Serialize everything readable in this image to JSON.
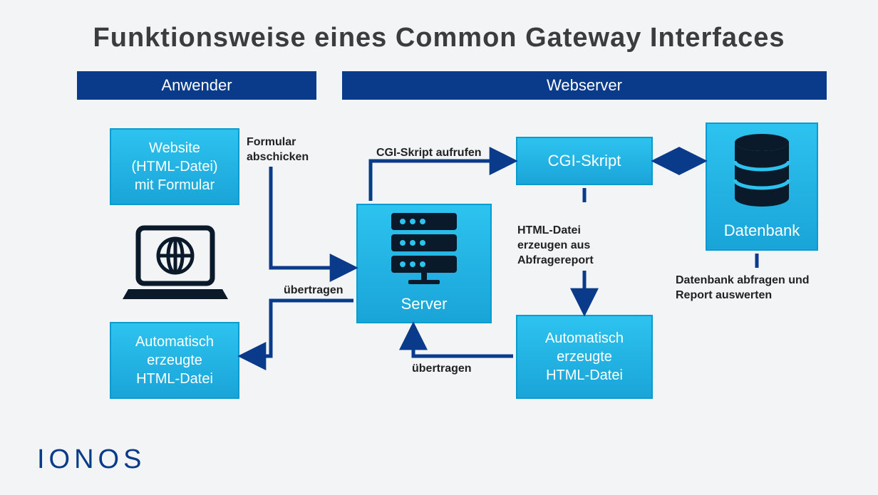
{
  "title": "Funktionsweise eines Common Gateway Interfaces",
  "sections": {
    "anwender": "Anwender",
    "webserver": "Webserver"
  },
  "nodes": {
    "website": "Website\n(HTML-Datei)\nmit Formular",
    "auto1": "Automatisch\nerzeugte\nHTML-Datei",
    "server": "Server",
    "cgi": "CGI-Skript",
    "auto2": "Automatisch\nerzeugte\nHTML-Datei",
    "db": "Datenbank"
  },
  "labels": {
    "formular": "Formular\nabschicken",
    "uebertragen1": "übertragen",
    "cgi_aufrufen": "CGI-Skript aufrufen",
    "html_erzeugen": "HTML-Datei\nerzeugen aus\nAbfragereport",
    "uebertragen2": "übertragen",
    "db_abfragen": "Datenbank abfragen und\nReport auswerten"
  },
  "brand": "IONOS",
  "colors": {
    "header_bg": "#0a3a8a",
    "node_top": "#2dc3ef",
    "node_bottom": "#1aa4d8",
    "arrow": "#0a3a8a",
    "icon_dark": "#0a1a2a"
  }
}
